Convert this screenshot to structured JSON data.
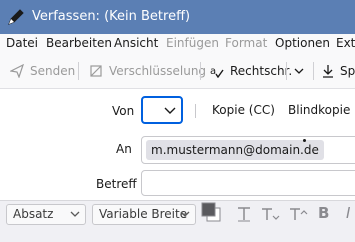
{
  "window": {
    "title": "Verfassen: (Kein Betreff)"
  },
  "menu": {
    "items": [
      "Datei",
      "Bearbeiten",
      "Ansicht",
      "Einfügen",
      "Format",
      "Optionen",
      "Extr"
    ]
  },
  "toolbar": {
    "send": "Senden",
    "encryption": "Verschlüsselung",
    "spelling": "Rechtschr.",
    "save_partial": "Sp"
  },
  "header": {
    "from_label": "Von",
    "cc_label": "Kopie (CC)",
    "bcc_label": "Blindkopie (Bl",
    "to_label": "An",
    "to_recipient": "m.mustermann@domain.de",
    "subject_label": "Betreff"
  },
  "format": {
    "paragraph": "Absatz",
    "font": "Variable Breite"
  },
  "colors": {
    "titlebar": "#5b7fb4",
    "focus": "#0060df"
  }
}
